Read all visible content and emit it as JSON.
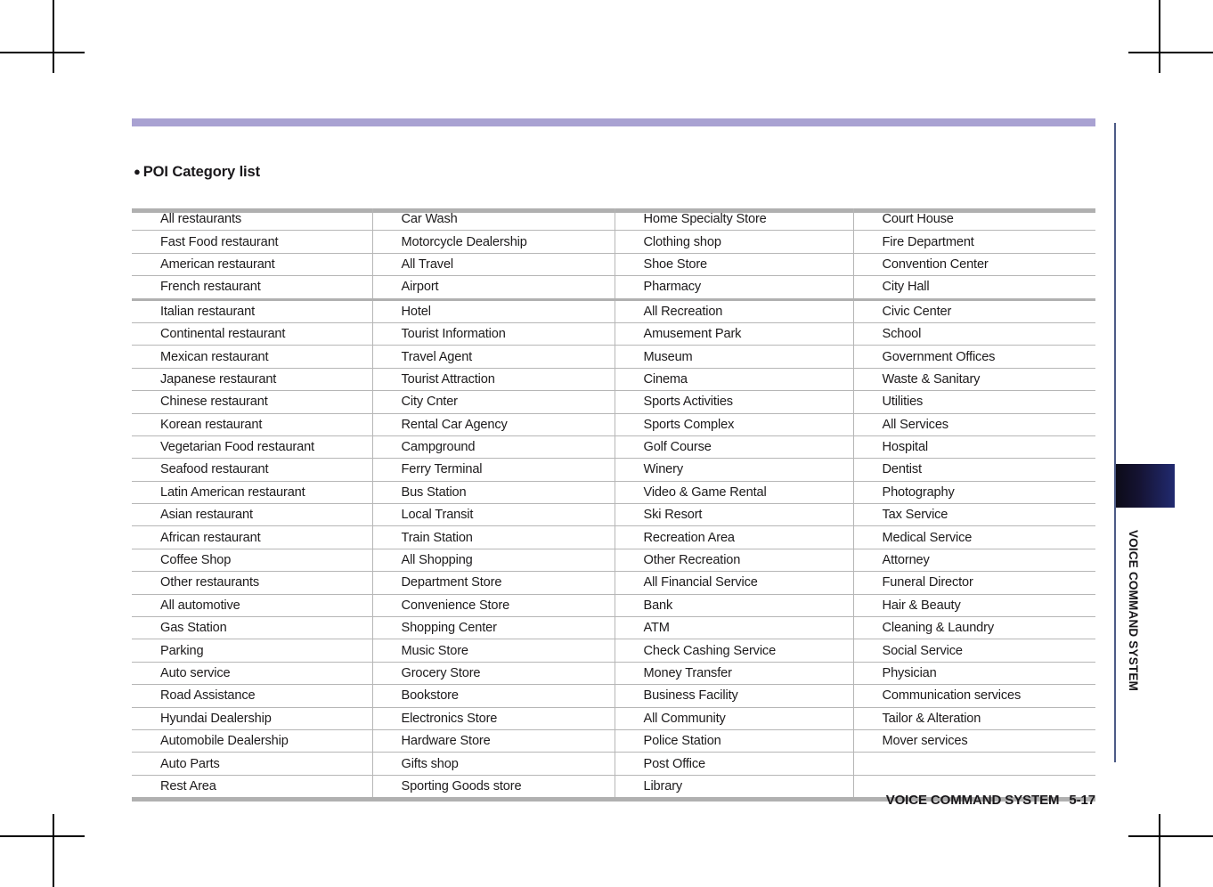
{
  "page": {
    "heading": "POI Category list",
    "bullet_glyph": "●",
    "side_tab_label": "VOICE COMMAND SYSTEM",
    "footer_title": "VOICE COMMAND SYSTEM",
    "footer_page": "5-17",
    "accent_bar_color": "#a9a2d2",
    "category_text_color": "#2b3182",
    "body_text_color": "#1d1b1c",
    "side_tab_color": "#212a70"
  },
  "table": {
    "columns": 4,
    "rows": [
      [
        "All restaurants",
        "Car Wash",
        "Home Specialty Store",
        "Court House"
      ],
      [
        "Fast Food restaurant",
        "Motorcycle Dealership",
        "Clothing shop",
        "Fire Department"
      ],
      [
        "American restaurant",
        "All Travel",
        "Shoe Store",
        "Convention Center"
      ],
      [
        "French restaurant",
        "Airport",
        "Pharmacy",
        "City Hall"
      ],
      [
        "Italian restaurant",
        "Hotel",
        "All Recreation",
        "Civic Center"
      ],
      [
        "Continental restaurant",
        "Tourist Information",
        "Amusement Park",
        "School"
      ],
      [
        "Mexican restaurant",
        "Travel Agent",
        "Museum",
        "Government Offices"
      ],
      [
        "Japanese restaurant",
        "Tourist Attraction",
        "Cinema",
        "Waste & Sanitary"
      ],
      [
        "Chinese restaurant",
        "City Cnter",
        "Sports Activities",
        "Utilities"
      ],
      [
        "Korean restaurant",
        "Rental Car Agency",
        "Sports Complex",
        "All Services"
      ],
      [
        "Vegetarian Food restaurant",
        "Campground",
        "Golf Course",
        "Hospital"
      ],
      [
        "Seafood restaurant",
        "Ferry Terminal",
        "Winery",
        "Dentist"
      ],
      [
        "Latin American restaurant",
        "Bus Station",
        "Video & Game Rental",
        "Photography"
      ],
      [
        "Asian restaurant",
        "Local Transit",
        "Ski Resort",
        "Tax Service"
      ],
      [
        "African restaurant",
        "Train Station",
        "Recreation Area",
        "Medical Service"
      ],
      [
        "Coffee Shop",
        "All Shopping",
        "Other Recreation",
        "Attorney"
      ],
      [
        "Other restaurants",
        "Department Store",
        "All Financial Service",
        "Funeral Director"
      ],
      [
        "All automotive",
        "Convenience Store",
        "Bank",
        "Hair & Beauty"
      ],
      [
        "Gas Station",
        "Shopping Center",
        "ATM",
        "Cleaning & Laundry"
      ],
      [
        "Parking",
        "Music Store",
        "Check Cashing Service",
        "Social Service"
      ],
      [
        "Auto service",
        "Grocery Store",
        "Money Transfer",
        "Physician"
      ],
      [
        "Road Assistance",
        "Bookstore",
        "Business Facility",
        "Communication services"
      ],
      [
        "Hyundai Dealership",
        "Electronics Store",
        "All Community",
        "Tailor & Alteration"
      ],
      [
        "Automobile Dealership",
        "Hardware Store",
        "Police Station",
        "Mover services"
      ],
      [
        "Auto Parts",
        "Gifts shop",
        "Post Office",
        ""
      ],
      [
        "Rest Area",
        "Sporting Goods store",
        "Library",
        ""
      ]
    ],
    "category_cells": [
      [
        0,
        0
      ],
      [
        2,
        1
      ],
      [
        4,
        2
      ],
      [
        9,
        3
      ],
      [
        15,
        1
      ],
      [
        16,
        2
      ],
      [
        17,
        0
      ],
      [
        22,
        2
      ]
    ],
    "section_break_after_row": 4
  }
}
